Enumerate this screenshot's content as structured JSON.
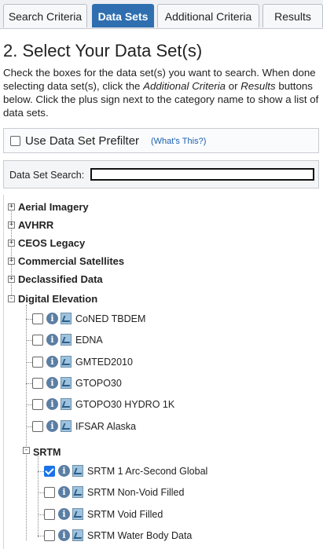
{
  "tabs": [
    {
      "label": "Search Criteria"
    },
    {
      "label": "Data Sets"
    },
    {
      "label": "Additional Criteria"
    },
    {
      "label": "Results"
    }
  ],
  "heading": "2. Select Your Data Set(s)",
  "instructions": {
    "part1": "Check the boxes for the data set(s) you want to search. When done selecting data set(s), click the ",
    "em1": "Additional Criteria",
    "part2": " or ",
    "em2": "Results",
    "part3": " buttons below. Click the plus sign next to the category name to show a list of data sets."
  },
  "prefilter": {
    "label": "Use Data Set Prefilter",
    "help": "(What's This?)"
  },
  "search": {
    "label": "Data Set Search:",
    "value": ""
  },
  "tree": {
    "categories": [
      {
        "label": "Aerial Imagery",
        "toggle": "+"
      },
      {
        "label": "AVHRR",
        "toggle": "+"
      },
      {
        "label": "CEOS Legacy",
        "toggle": "+"
      },
      {
        "label": "Commercial Satellites",
        "toggle": "+"
      },
      {
        "label": "Declassified Data",
        "toggle": "+"
      },
      {
        "label": "Digital Elevation",
        "toggle": "-"
      }
    ],
    "datasets": [
      {
        "label": "CoNED TBDEM",
        "checked": false
      },
      {
        "label": "EDNA",
        "checked": false
      },
      {
        "label": "GMTED2010",
        "checked": false
      },
      {
        "label": "GTOPO30",
        "checked": false
      },
      {
        "label": "GTOPO30 HYDRO 1K",
        "checked": false
      },
      {
        "label": "IFSAR Alaska",
        "checked": false
      }
    ],
    "subcategory": {
      "label": "SRTM",
      "toggle": "-"
    },
    "srtm_datasets": [
      {
        "label": "SRTM 1 Arc-Second Global",
        "checked": true
      },
      {
        "label": "SRTM Non-Void Filled",
        "checked": false
      },
      {
        "label": "SRTM Void Filled",
        "checked": false
      },
      {
        "label": "SRTM Water Body Data",
        "checked": false
      }
    ]
  },
  "colors": {
    "active_tab": "#2f6fb0",
    "checkbox_checked": "#1a73e8",
    "link": "#1a5fb4"
  }
}
